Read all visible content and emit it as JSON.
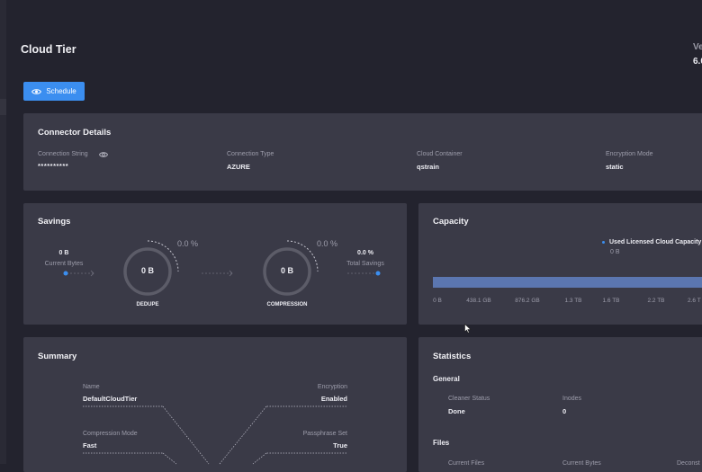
{
  "header": {
    "title": "Cloud Tier",
    "version_label": "Ve",
    "version_value": "6.0"
  },
  "toolbar": {
    "schedule_label": "Schedule",
    "schedule_icon": "eye-icon"
  },
  "connector": {
    "title": "Connector Details",
    "connection_string_label": "Connection String",
    "connection_string_value": "**********",
    "connection_type_label": "Connection Type",
    "connection_type_value": "AZURE",
    "cloud_container_label": "Cloud Container",
    "cloud_container_value": "qstrain",
    "encryption_mode_label": "Encryption Mode",
    "encryption_mode_value": "static"
  },
  "savings": {
    "title": "Savings",
    "current_bytes_value": "0 B",
    "current_bytes_label": "Current Bytes",
    "dedupe_value": "0 B",
    "dedupe_percent": "0.0 %",
    "dedupe_label": "DEDUPE",
    "compression_value": "0 B",
    "compression_percent": "0.0 %",
    "compression_label": "COMPRESSION",
    "total_savings_value": "0.0 %",
    "total_savings_label": "Total Savings"
  },
  "capacity": {
    "title": "Capacity",
    "legend_label": "Used Licensed Cloud Capacity",
    "legend_value": "0 B",
    "bar_color": "#5b76b0",
    "used_fraction": 0,
    "ticks": [
      "0 B",
      "438.1 GB",
      "876.2 GB",
      "1.3 TB",
      "1.6 TB",
      "2.2 TB",
      "2.6 T"
    ]
  },
  "summary": {
    "title": "Summary",
    "name_label": "Name",
    "name_value": "DefaultCloudTier",
    "encryption_label": "Encryption",
    "encryption_value": "Enabled",
    "compression_mode_label": "Compression Mode",
    "compression_mode_value": "Fast",
    "passphrase_label": "Passphrase Set",
    "passphrase_value": "True"
  },
  "statistics": {
    "title": "Statistics",
    "general_title": "General",
    "cleaner_status_label": "Cleaner Status",
    "cleaner_status_value": "Done",
    "inodes_label": "Inodes",
    "inodes_value": "0",
    "files_title": "Files",
    "files_col1_label": "Current Files",
    "files_col2_label": "Current Bytes",
    "files_col3_label": "Deconst"
  },
  "colors": {
    "accent": "#3b8ef0",
    "panel": "#3a3a47",
    "background": "#23232e"
  }
}
